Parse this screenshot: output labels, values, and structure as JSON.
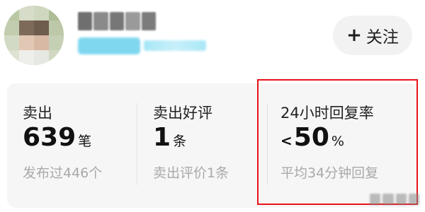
{
  "header": {
    "follow_button": {
      "icon": "plus-icon",
      "icon_glyph": "+",
      "label": "关注"
    }
  },
  "stats": [
    {
      "title": "卖出",
      "prefix": "",
      "value": "639",
      "unit": "笔",
      "sub": "发布过446个"
    },
    {
      "title": "卖出好评",
      "prefix": "",
      "value": "1",
      "unit": "条",
      "sub": "卖出评价1条"
    },
    {
      "title": "24小时回复率",
      "prefix": "<",
      "value": "50",
      "unit": "%",
      "sub": "平均34分钟回复"
    }
  ],
  "colors": {
    "highlight_border": "#e8121b",
    "panel_background": "#f6f6f6",
    "follow_button_background": "#f2f2f2",
    "subtext": "#a9a9a9",
    "tag_background": "#7fd7ef"
  }
}
